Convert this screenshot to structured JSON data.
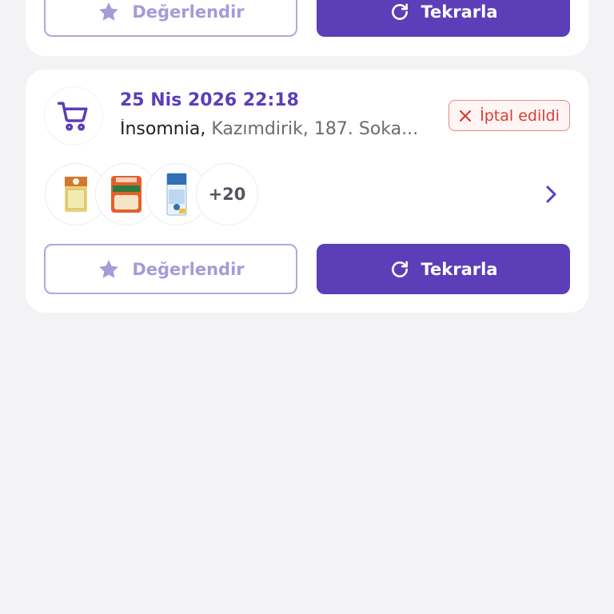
{
  "previous_order": {
    "rate_label": "Değerlendir",
    "repeat_label": "Tekrarla"
  },
  "order": {
    "date": "25 Nis 2026 22:18",
    "store": "İnsomnia,",
    "address": " Kazımdirik, 187. Soka...",
    "status": "İptal edildi",
    "more_items": "+20",
    "rate_label": "Değerlendir",
    "repeat_label": "Tekrarla"
  },
  "icons": {
    "cart": "cart-icon",
    "star": "star-icon",
    "refresh": "refresh-icon",
    "close": "close-icon",
    "chevron": "chevron-right-icon"
  },
  "colors": {
    "primary": "#5b3eb8",
    "rate_text": "#a79ad8",
    "cancel_red": "#db3b32",
    "background": "#f3f3f5"
  }
}
